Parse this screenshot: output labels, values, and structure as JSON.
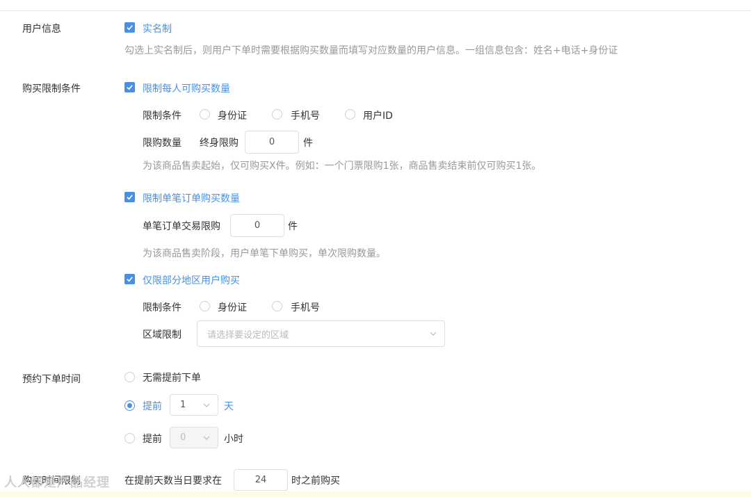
{
  "user_info": {
    "label": "用户信息",
    "realname_label": "实名制",
    "realname_hint": "勾选上实名制后，则用户下单时需要根据购买数量而填写对应数量的用户信息。一组信息包含：姓名+电话+身份证"
  },
  "purchase_limit": {
    "label": "购买限制条件",
    "per_person": {
      "label": "限制每人可购买数量",
      "condition_label": "限制条件",
      "options": [
        "身份证",
        "手机号",
        "用户ID"
      ],
      "qty_label": "限购数量",
      "lifetime_label": "终身限购",
      "qty_value": "0",
      "unit": "件",
      "hint": "为该商品售卖起始，仅可购买X件。例如：一个门票限购1张，商品售卖结束前仅可购买1张。"
    },
    "per_order": {
      "label": "限制单笔订单购买数量",
      "qty_label": "单笔订单交易限购",
      "qty_value": "0",
      "unit": "件",
      "hint": "为该商品售卖阶段，用户单笔下单购买，单次限购数量。"
    },
    "region": {
      "label": "仅限部分地区用户购买",
      "condition_label": "限制条件",
      "options": [
        "身份证",
        "手机号"
      ],
      "area_label": "区域限制",
      "area_placeholder": "请选择要设定的区域"
    }
  },
  "reserve_time": {
    "label": "预约下单时间",
    "option_none": "无需提前下单",
    "option_days_prefix": "提前",
    "days_value": "1",
    "days_unit": "天",
    "option_hours_prefix": "提前",
    "hours_value": "0",
    "hours_unit": "小时"
  },
  "buy_time_limit": {
    "label": "购买时间限制",
    "prefix": "在提前天数当日要求在",
    "value": "24",
    "suffix": "时之前购买"
  },
  "watermark": "人人都是产品经理",
  "colors": {
    "accent": "#4a90e2",
    "text": "#333333",
    "hint": "#999999"
  }
}
